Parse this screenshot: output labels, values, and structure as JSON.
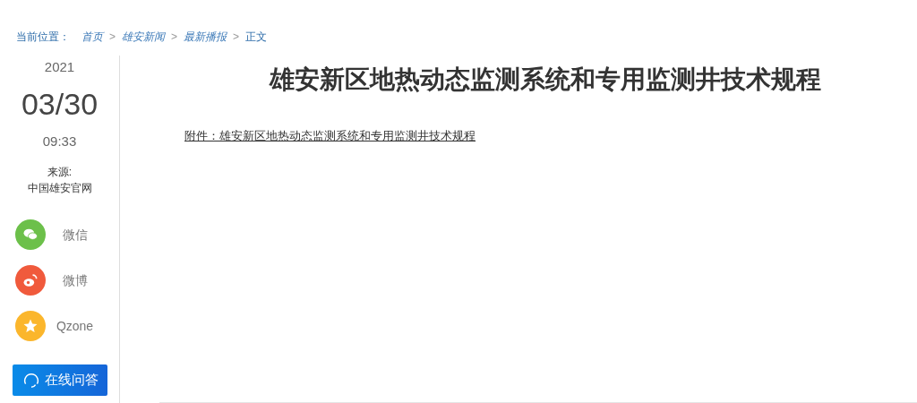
{
  "breadcrumb": {
    "label": "当前位置：",
    "items": [
      {
        "kind": "link",
        "text": "首页"
      },
      {
        "kind": "separator",
        "text": ">"
      },
      {
        "kind": "link",
        "text": "雄安新闻"
      },
      {
        "kind": "separator",
        "text": ">"
      },
      {
        "kind": "link",
        "text": "最新播报"
      },
      {
        "kind": "separator",
        "text": ">"
      },
      {
        "kind": "current",
        "text": "正文"
      }
    ]
  },
  "date": {
    "year": "2021",
    "day": "03/30",
    "time": "09:33"
  },
  "source": {
    "label": "来源:",
    "name": "中国雄安官网"
  },
  "share": [
    {
      "kind": "wechat",
      "label": "微信",
      "color": "#6cc04a"
    },
    {
      "kind": "weibo",
      "label": "微博",
      "color": "#f05a3c"
    },
    {
      "kind": "qzone",
      "label": "Qzone",
      "color": "#fbb62c"
    }
  ],
  "qa_button": "在线问答",
  "article": {
    "title": "雄安新区地热动态监测系统和专用监测井技术规程",
    "attachment": "附件：雄安新区地热动态监测系统和专用监测井技术规程"
  }
}
